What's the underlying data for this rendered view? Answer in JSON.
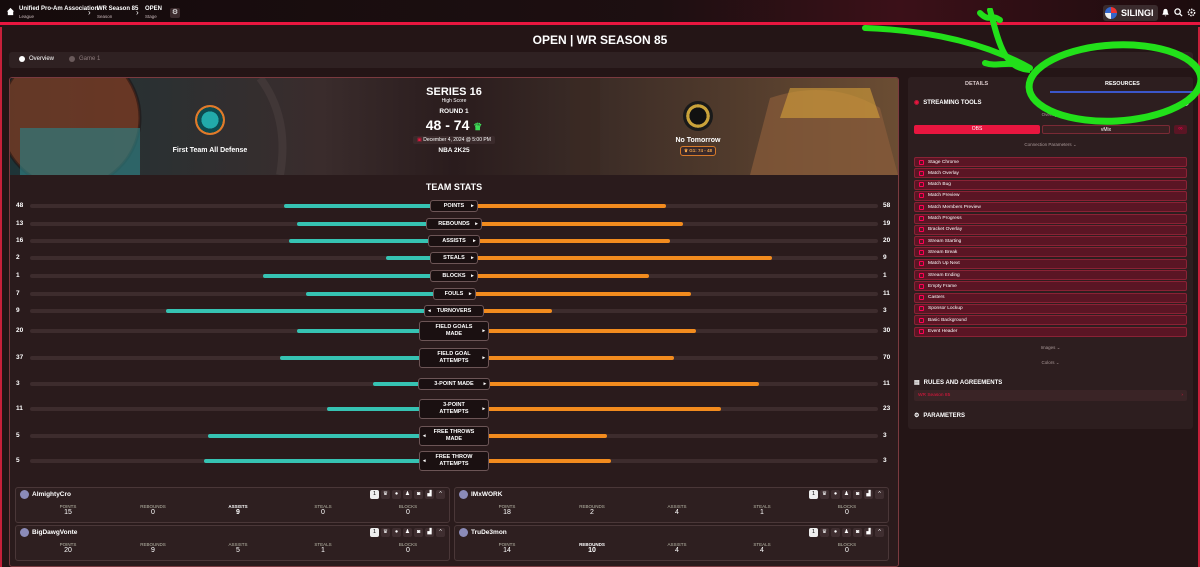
{
  "breadcrumb": [
    {
      "label": "Unified Pro-Am Association",
      "sub": "League"
    },
    {
      "label": "WR Season 85",
      "sub": "Season"
    },
    {
      "label": "OPEN",
      "sub": "Stage"
    }
  ],
  "user": {
    "name": "SILINGI"
  },
  "page_title": "OPEN | WR SEASON 85",
  "tabs": [
    {
      "label": "Overview"
    },
    {
      "label": "Game 1"
    }
  ],
  "match": {
    "series": "SERIES 16",
    "subtitle": "High Score",
    "round": "ROUND 1",
    "score": "48 - 74",
    "date": "December 4, 2024 @ 5:00 PM",
    "game": "NBA 2K25",
    "home": "First Team All Defense",
    "away": "No Tomorrow",
    "away_badge": "G1: 74 - 48"
  },
  "team_stats_title": "TEAM STATS",
  "stats": [
    {
      "label": "POINTS",
      "left": 48,
      "right": 58
    },
    {
      "label": "REBOUNDS",
      "left": 13,
      "right": 19
    },
    {
      "label": "ASSISTS",
      "left": 16,
      "right": 20
    },
    {
      "label": "STEALS",
      "left": 2,
      "right": 9
    },
    {
      "label": "BLOCKS",
      "left": 1,
      "right": 1
    },
    {
      "label": "FOULS",
      "left": 7,
      "right": 11
    },
    {
      "label": "TURNOVERS",
      "left": 9,
      "right": 3
    },
    {
      "label": "FIELD GOALS MADE",
      "left": 20,
      "right": 30
    },
    {
      "label": "FIELD GOAL ATTEMPTS",
      "left": 37,
      "right": 70
    },
    {
      "label": "3-POINT MADE",
      "left": 3,
      "right": 11
    },
    {
      "label": "3-POINT ATTEMPTS",
      "left": 11,
      "right": 23
    },
    {
      "label": "FREE THROWS MADE",
      "left": 5,
      "right": 3
    },
    {
      "label": "FREE THROW ATTEMPTS",
      "left": 5,
      "right": 3
    }
  ],
  "bar_fill": {
    "left": [
      0.4,
      0.37,
      0.39,
      0.16,
      0.45,
      0.35,
      0.68,
      0.37,
      0.41,
      0.19,
      0.3,
      0.58,
      0.59
    ],
    "right": [
      0.5,
      0.54,
      0.51,
      0.75,
      0.46,
      0.56,
      0.23,
      0.57,
      0.52,
      0.72,
      0.63,
      0.36,
      0.37
    ]
  },
  "players": [
    {
      "name": "AlmightyCro",
      "num": "1",
      "points": "15",
      "rebounds": "0",
      "assists": "9",
      "steals": "0",
      "blocks": "0"
    },
    {
      "name": "IMxWORK",
      "num": "1",
      "points": "18",
      "rebounds": "2",
      "assists": "4",
      "steals": "1",
      "blocks": "0"
    },
    {
      "name": "BigDawgVonte",
      "num": "1",
      "points": "20",
      "rebounds": "9",
      "assists": "5",
      "steals": "1",
      "blocks": "0"
    },
    {
      "name": "TruDe3mon",
      "num": "1",
      "points": "14",
      "rebounds": "10",
      "assists": "4",
      "steals": "4",
      "blocks": "0"
    }
  ],
  "stat_labels": {
    "points": "POINTS",
    "rebounds": "REBOUNDS",
    "assists": "ASSISTS",
    "steals": "STEALS",
    "blocks": "BLOCKS"
  },
  "side": {
    "tab_details": "DETAILS",
    "tab_resources": "RESOURCES",
    "streaming_tools": "STREAMING TOOLS",
    "overlays": "Overlays",
    "obs": "OBS",
    "vmix": "vMix",
    "connection": "Connection Parameters",
    "items": [
      "Stage Chrome",
      "Match Overlay",
      "Match Bug",
      "Match Preview",
      "Match Members Preview",
      "Match Progress",
      "Bracket Overlay",
      "Stream Starting",
      "Stream Break",
      "Match Up Next",
      "Stream Ending",
      "Empty Frame",
      "Casters",
      "Sponsor Lockup",
      "Basic Background",
      "Event Header"
    ],
    "images": "Images",
    "colors": "Colors",
    "rules": "RULES AND AGREEMENTS",
    "rules_link": "WR Season 85",
    "parameters": "PARAMETERS"
  },
  "colors": {
    "accent": "#e8163f",
    "home": "#36c3b3",
    "away": "#f28b1e",
    "annotation": "#22e01a"
  }
}
